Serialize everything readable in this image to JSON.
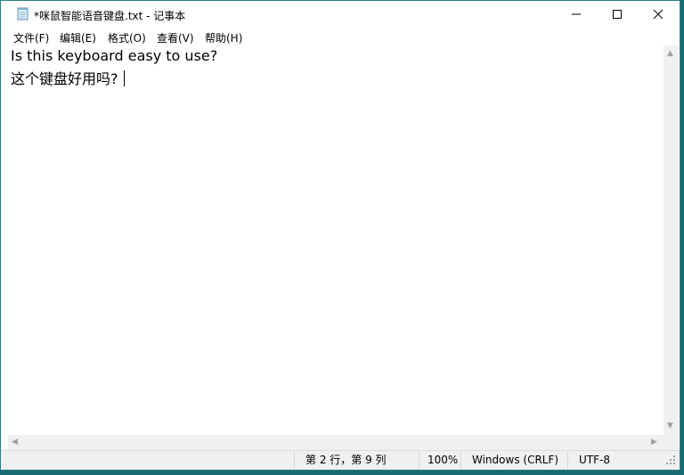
{
  "window": {
    "title": "*咪鼠智能语音键盘.txt - 记事本"
  },
  "menu": {
    "file": "文件(F)",
    "edit": "编辑(E)",
    "format": "格式(O)",
    "view": "查看(V)",
    "help": "帮助(H)"
  },
  "editor": {
    "line1": "Is this keyboard easy to use?",
    "line2": "这个键盘好用吗?"
  },
  "status": {
    "position": "第 2 行，第 9 列",
    "zoom": "100%",
    "line_ending": "Windows (CRLF)",
    "encoding": "UTF-8"
  },
  "icons": {
    "app": "notepad-icon",
    "minimize": "minimize-icon",
    "maximize": "maximize-icon",
    "close": "close-icon"
  },
  "colors": {
    "desktop": "#1a6a73",
    "statusbar": "#f0f0f0",
    "scrollbar": "#f0f0f0"
  }
}
